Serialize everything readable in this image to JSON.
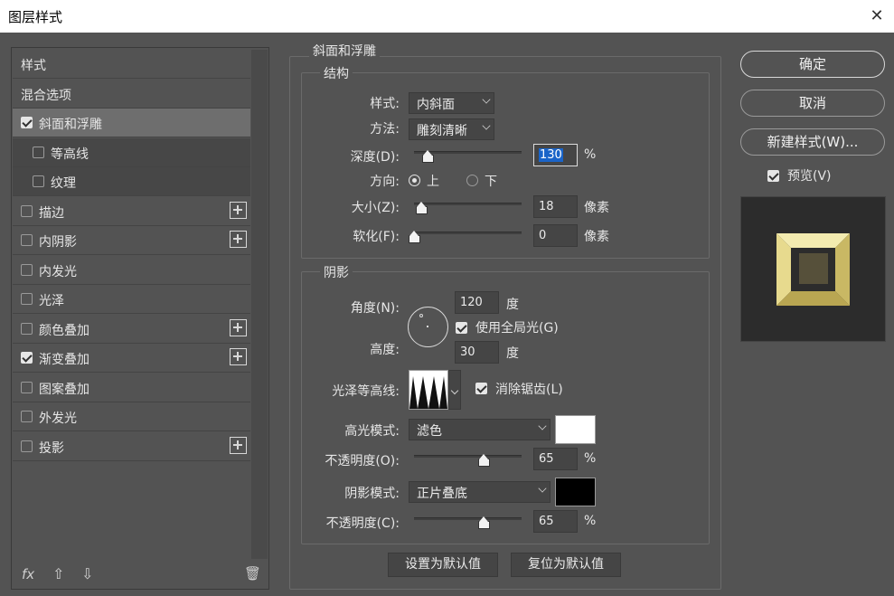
{
  "window": {
    "title": "图层样式",
    "close_glyph": "✕"
  },
  "styles_list": {
    "items": [
      {
        "label": "样式",
        "checkbox": false,
        "plus": false,
        "checked": false
      },
      {
        "label": "混合选项",
        "checkbox": false,
        "plus": false,
        "checked": false
      },
      {
        "label": "斜面和浮雕",
        "checkbox": true,
        "plus": false,
        "checked": true,
        "selected": true
      },
      {
        "label": "等高线",
        "checkbox": true,
        "plus": false,
        "checked": false,
        "sub": true
      },
      {
        "label": "纹理",
        "checkbox": true,
        "plus": false,
        "checked": false,
        "sub": true
      },
      {
        "label": "描边",
        "checkbox": true,
        "plus": true,
        "checked": false
      },
      {
        "label": "内阴影",
        "checkbox": true,
        "plus": true,
        "checked": false
      },
      {
        "label": "内发光",
        "checkbox": true,
        "plus": false,
        "checked": false
      },
      {
        "label": "光泽",
        "checkbox": true,
        "plus": false,
        "checked": false
      },
      {
        "label": "颜色叠加",
        "checkbox": true,
        "plus": true,
        "checked": false
      },
      {
        "label": "渐变叠加",
        "checkbox": true,
        "plus": true,
        "checked": true
      },
      {
        "label": "图案叠加",
        "checkbox": true,
        "plus": false,
        "checked": false
      },
      {
        "label": "外发光",
        "checkbox": true,
        "plus": false,
        "checked": false
      },
      {
        "label": "投影",
        "checkbox": true,
        "plus": true,
        "checked": false
      }
    ],
    "bottom_icons": {
      "fx": "fx",
      "up": "⇧",
      "down": "⇩",
      "trash": "🗑"
    }
  },
  "bevel": {
    "group_title": "斜面和浮雕",
    "structure": {
      "title": "结构",
      "style_label": "样式:",
      "style_value": "内斜面",
      "technique_label": "方法:",
      "technique_value": "雕刻清晰",
      "depth_label": "深度(D):",
      "depth_value": "130",
      "depth_unit": "%",
      "depth_slider": 0.13,
      "direction_label": "方向:",
      "dir_up": "上",
      "dir_down": "下",
      "direction_selected": "上",
      "size_label": "大小(Z):",
      "size_value": "18",
      "size_unit": "像素",
      "size_slider": 0.07,
      "soften_label": "软化(F):",
      "soften_value": "0",
      "soften_unit": "像素",
      "soften_slider": 0.0
    },
    "shading": {
      "title": "阴影",
      "angle_label": "角度(N):",
      "angle_value": "120",
      "angle_unit": "度",
      "global_light_label": "使用全局光(G)",
      "global_light_checked": true,
      "altitude_label": "高度:",
      "altitude_value": "30",
      "altitude_unit": "度",
      "gloss_label": "光泽等高线:",
      "antialias_label": "消除锯齿(L)",
      "antialias_checked": true,
      "highlight_mode_label": "高光模式:",
      "highlight_mode_value": "滤色",
      "highlight_color": "#ffffff",
      "highlight_opacity_label": "不透明度(O):",
      "highlight_opacity_value": "65",
      "highlight_opacity_unit": "%",
      "highlight_opacity_slider": 0.65,
      "shadow_mode_label": "阴影模式:",
      "shadow_mode_value": "正片叠底",
      "shadow_color": "#000000",
      "shadow_opacity_label": "不透明度(C):",
      "shadow_opacity_value": "65",
      "shadow_opacity_unit": "%",
      "shadow_opacity_slider": 0.65
    },
    "make_default": "设置为默认值",
    "reset_default": "复位为默认值"
  },
  "buttons": {
    "ok": "确定",
    "cancel": "取消",
    "new_style": "新建样式(W)..."
  },
  "preview": {
    "label": "预览(V)",
    "checked": true
  },
  "colors": {
    "panel_bg": "#535353",
    "accent": "#1a64c8",
    "gold_light": "#f1e7a3",
    "gold_dark": "#8c7b2e"
  }
}
